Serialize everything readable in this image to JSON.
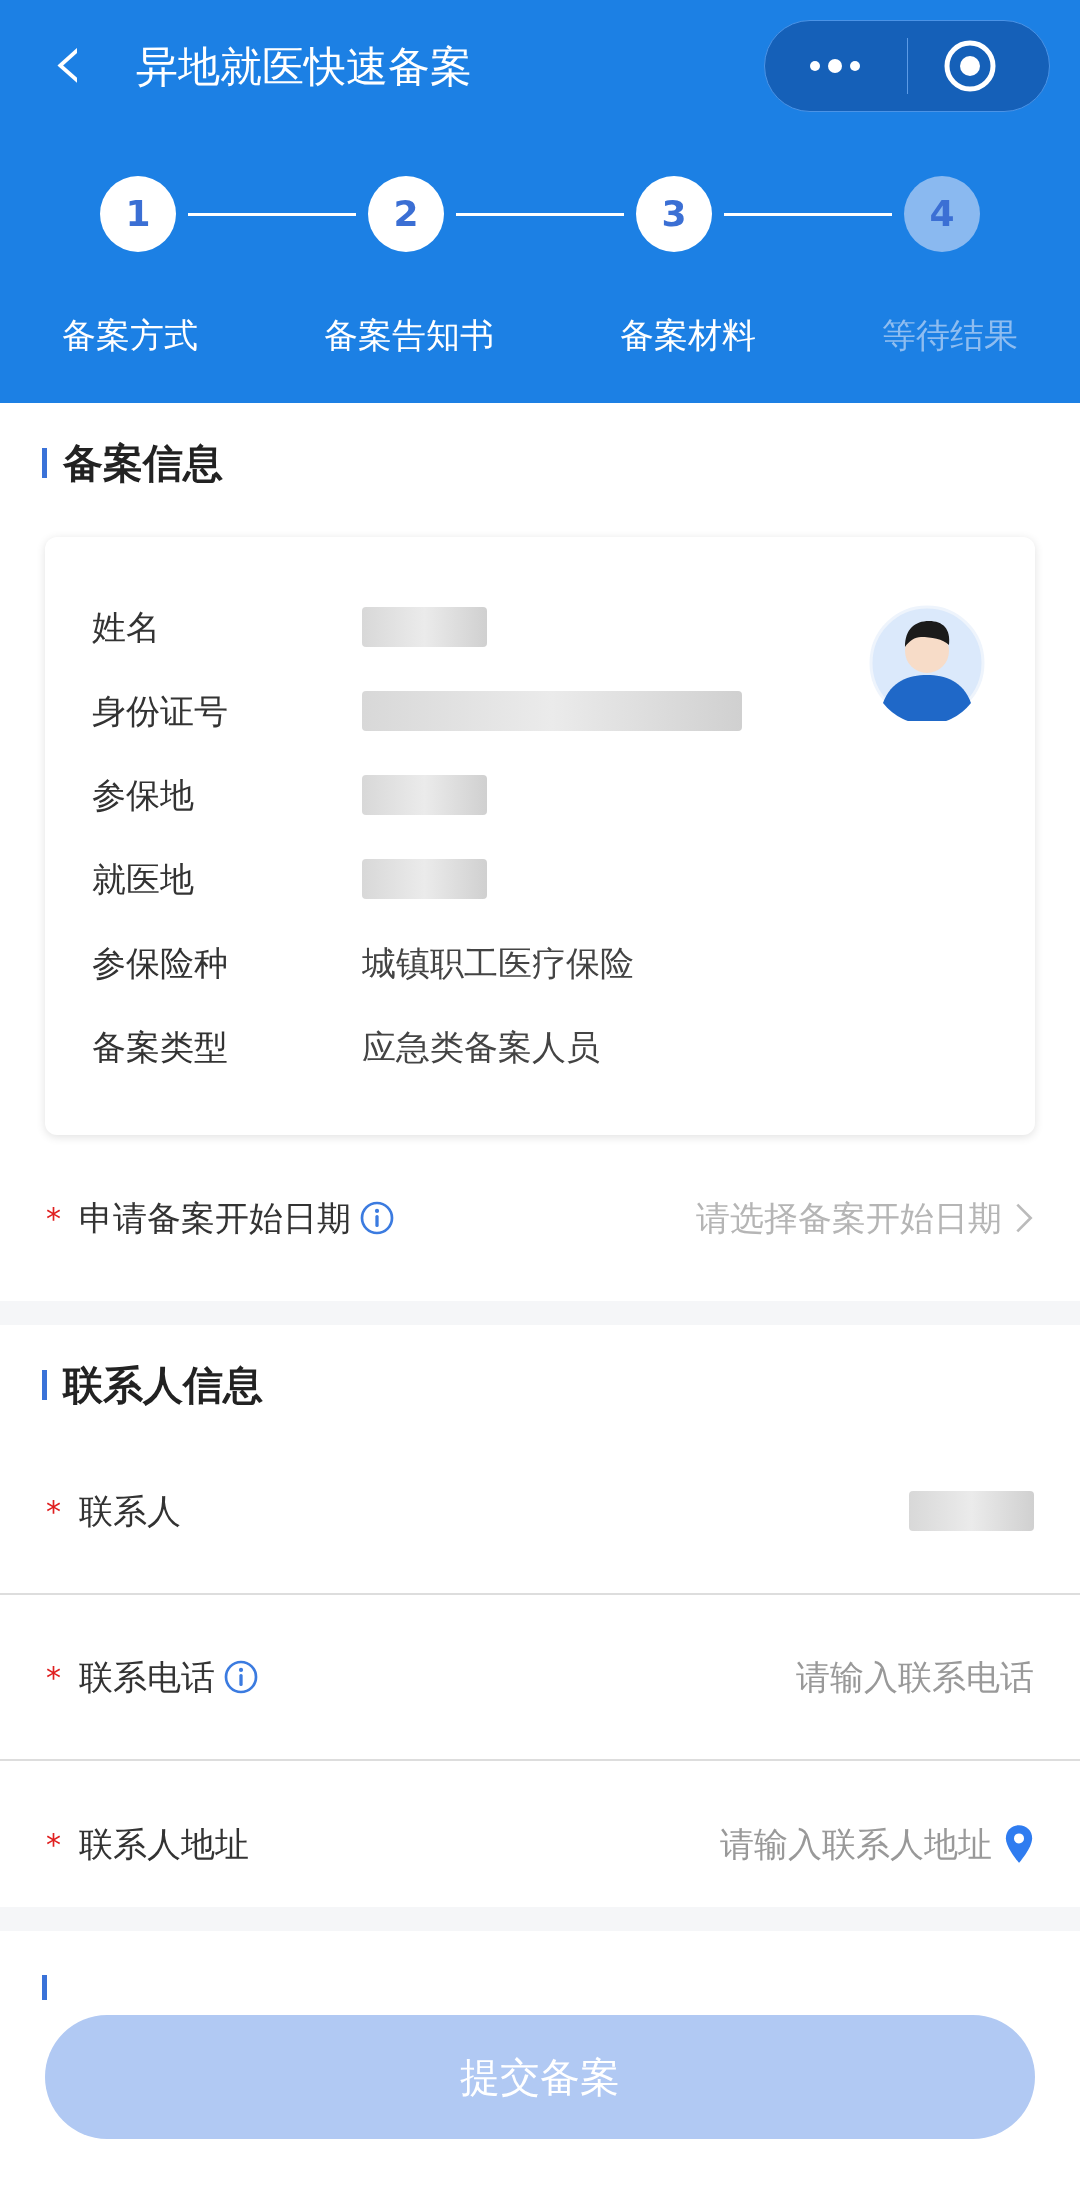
{
  "header": {
    "title": "异地就医快速备案",
    "back": "‹"
  },
  "steps": [
    {
      "number": "1",
      "label": "备案方式",
      "done": true
    },
    {
      "number": "2",
      "label": "备案告知书",
      "done": true
    },
    {
      "number": "3",
      "label": "备案材料",
      "done": true
    },
    {
      "number": "4",
      "label": "等待结果",
      "done": false
    }
  ],
  "record_section": {
    "title": "备案信息",
    "rows": [
      {
        "label": "姓名",
        "kind": "redacted"
      },
      {
        "label": "身份证号",
        "kind": "redacted_long"
      },
      {
        "label": "参保地",
        "kind": "redacted"
      },
      {
        "label": "就医地",
        "kind": "redacted"
      },
      {
        "label": "参保险种",
        "kind": "text",
        "value": "城镇职工医疗保险"
      },
      {
        "label": "备案类型",
        "kind": "text",
        "value": "应急类备案人员"
      }
    ],
    "start_date": {
      "label": "申请备案开始日期",
      "required_mark": "*",
      "info": true,
      "kind": "select",
      "placeholder": "请选择备案开始日期",
      "chevron": true
    }
  },
  "contact_section": {
    "title": "联系人信息",
    "rows": [
      {
        "label": "联系人",
        "required_mark": "*",
        "info": false,
        "kind": "redacted"
      },
      {
        "label": "联系电话",
        "required_mark": "*",
        "info": true,
        "kind": "input",
        "placeholder": "请输入联系电话"
      },
      {
        "label": "联系人地址",
        "required_mark": "*",
        "info": false,
        "kind": "input",
        "placeholder": "请输入联系人地址",
        "location_pin": true
      }
    ]
  },
  "submit": {
    "label": "提交备案",
    "disabled": true
  }
}
